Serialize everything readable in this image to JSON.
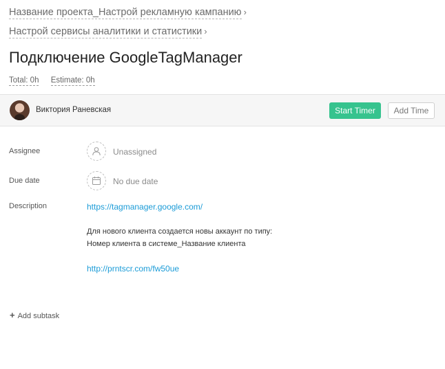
{
  "breadcrumbs": [
    {
      "label": "Название проекта_Настрой рекламную кампанию",
      "chevron": "›"
    },
    {
      "label": "Настрой сервисы аналитики и статистики",
      "chevron": "›"
    }
  ],
  "task": {
    "title": "Подключение GoogleTagManager",
    "total": "Total: 0h",
    "estimate": "Estimate: 0h"
  },
  "header": {
    "user_name": "Виктория Раневская",
    "start_timer_label": "Start Timer",
    "add_time_label": "Add Time"
  },
  "fields": {
    "assignee_label": "Assignee",
    "assignee_value": "Unassigned",
    "due_label": "Due date",
    "due_value": "No due date",
    "description_label": "Description"
  },
  "description": {
    "link1": "https://tagmanager.google.com/",
    "line1": "Для нового клиента создается новы аккаунт по типу:",
    "line2": "Номер клиента в системе_Название клиента",
    "link2": "http://prntscr.com/fw50ue"
  },
  "subtask": {
    "plus": "+",
    "label": "Add subtask"
  },
  "colors": {
    "accent_green": "#36c38e",
    "link_blue": "#1a9bd7"
  },
  "icons": {
    "assignee": "user-icon",
    "due": "calendar-icon",
    "breadcrumb": "chevron-right-icon"
  }
}
